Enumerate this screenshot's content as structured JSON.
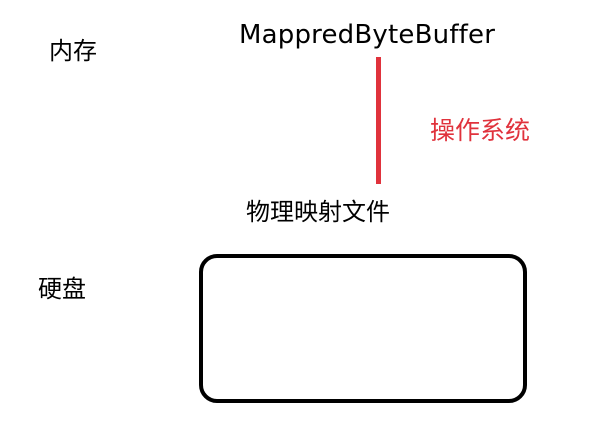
{
  "labels": {
    "memory": "内存",
    "disk": "硬盘",
    "buffer": "MappredByteBuffer",
    "operating_system": "操作系统",
    "mapped_file": "物理映射文件"
  },
  "colors": {
    "connector": "#e0323c",
    "os_label": "#e0323c",
    "box_border": "#000000",
    "text": "#000000",
    "background": "#ffffff"
  }
}
